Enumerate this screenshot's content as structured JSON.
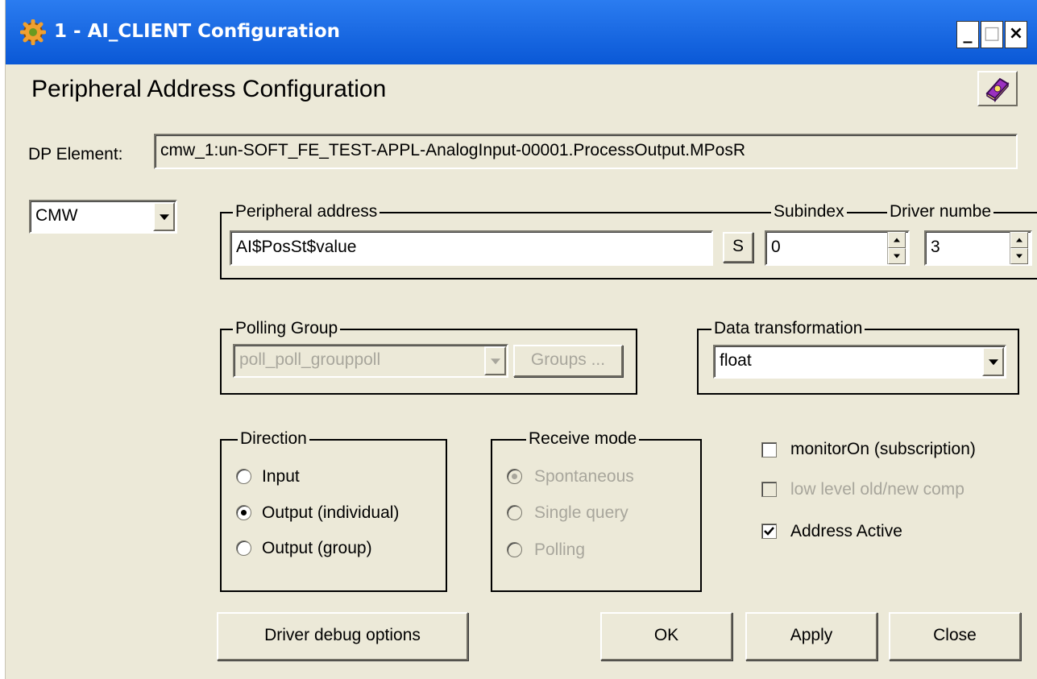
{
  "window": {
    "title": "1 - AI_CLIENT Configuration",
    "minimize_label": "_",
    "maximize_label": "□",
    "close_label": "×"
  },
  "heading": "Peripheral Address Configuration",
  "dp_element": {
    "label": "DP Element:",
    "value": "cmw_1:un-SOFT_FE_TEST-APPL-AnalogInput-00001.ProcessOutput.MPosR"
  },
  "driver_type": {
    "selected": "CMW"
  },
  "peripheral": {
    "legend": "Peripheral address",
    "value": "AI$PosSt$value",
    "s_button": "S",
    "subindex_label": "Subindex",
    "subindex_value": "0",
    "driver_label": "Driver numbe",
    "driver_value": "3"
  },
  "polling_group": {
    "legend": "Polling Group",
    "selected": "poll_poll_grouppoll",
    "groups_button": "Groups ..."
  },
  "data_transformation": {
    "legend": "Data transformation",
    "selected": "float"
  },
  "direction": {
    "legend": "Direction",
    "options": [
      {
        "label": "Input",
        "checked": false
      },
      {
        "label": "Output (individual)",
        "checked": true
      },
      {
        "label": "Output (group)",
        "checked": false
      }
    ]
  },
  "receive_mode": {
    "legend": "Receive mode",
    "options": [
      {
        "label": "Spontaneous",
        "checked": true
      },
      {
        "label": "Single query",
        "checked": false
      },
      {
        "label": "Polling",
        "checked": false
      }
    ]
  },
  "checkboxes": [
    {
      "label": "monitorOn (subscription)",
      "checked": false,
      "enabled": true
    },
    {
      "label": "low level old/new comp",
      "checked": false,
      "enabled": false
    },
    {
      "label": "Address Active",
      "checked": true,
      "enabled": true
    }
  ],
  "buttons": {
    "driver_debug": "Driver debug options",
    "ok": "OK",
    "apply": "Apply",
    "close": "Close"
  },
  "colors": {
    "titlebar": "#0a58d6",
    "dialog_bg": "#ece9d8",
    "disabled_text": "#a8a69c"
  }
}
